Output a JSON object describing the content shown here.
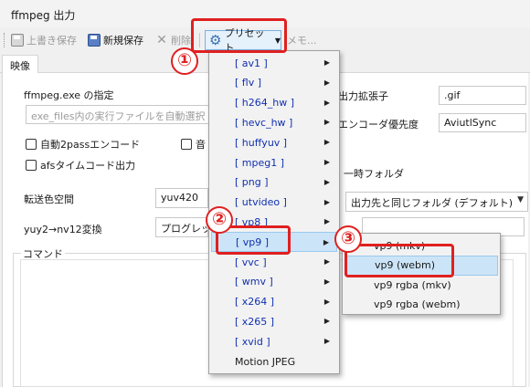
{
  "window": {
    "title": "ffmpeg 出力"
  },
  "toolbar": {
    "overwrite_save": "上書き保存",
    "new_save": "新規保存",
    "delete": "削除",
    "preset": "プリセット",
    "memo": "メモ..."
  },
  "tabs": [
    "映像"
  ],
  "form": {
    "exe_label": "ffmpeg.exe の指定",
    "exe_placeholder": "exe_files内の実行ファイルを自動選択",
    "auto2pass": "自動2passエンコード",
    "audio_hidden": "音",
    "afs": "afsタイムコード出力",
    "ext_label": "出力拡張子",
    "ext_value": ".gif",
    "encoder_pri_label": "エンコーダ優先度",
    "encoder_pri_value": "AviutlSync",
    "temp_folder_label": "一時フォルダ",
    "temp_folder_value": "出力先と同じフォルダ (デフォルト)",
    "colorspace_label": "転送色空間",
    "colorspace_value": "yuv420",
    "nv12_label": "yuy2→nv12変換",
    "nv12_value": "プログレッシ",
    "command_label": "コマンド"
  },
  "preset_menu": {
    "items": [
      {
        "label": "[ av1 ]",
        "sub": true
      },
      {
        "label": "[ flv ]",
        "sub": true
      },
      {
        "label": "[ h264_hw ]",
        "sub": true
      },
      {
        "label": "[ hevc_hw ]",
        "sub": true
      },
      {
        "label": "[ huffyuv ]",
        "sub": true
      },
      {
        "label": "[ mpeg1 ]",
        "sub": true
      },
      {
        "label": "[ png ]",
        "sub": true
      },
      {
        "label": "[ utvideo ]",
        "sub": true
      },
      {
        "label": "[ vp8 ]",
        "sub": true
      },
      {
        "label": "[ vp9 ]",
        "sub": true
      },
      {
        "label": "[ vvc ]",
        "sub": true
      },
      {
        "label": "[ wmv ]",
        "sub": true
      },
      {
        "label": "[ x264 ]",
        "sub": true
      },
      {
        "label": "[ x265 ]",
        "sub": true
      },
      {
        "label": "[ xvid ]",
        "sub": true
      },
      {
        "label": "Motion JPEG",
        "sub": false
      }
    ],
    "highlighted": "[ vp9 ]"
  },
  "vp9_submenu": {
    "items": [
      "vp9 (mkv)",
      "vp9 (webm)",
      "vp9 rgba (mkv)",
      "vp9 rgba (webm)"
    ],
    "highlighted": "vp9 (webm)"
  },
  "annotations": {
    "step1": "①",
    "step2": "②",
    "step3": "③"
  },
  "colors": {
    "annotation": "#e02020",
    "menu_highlight": "#cce4f7",
    "menu_text": "#1030b0"
  }
}
